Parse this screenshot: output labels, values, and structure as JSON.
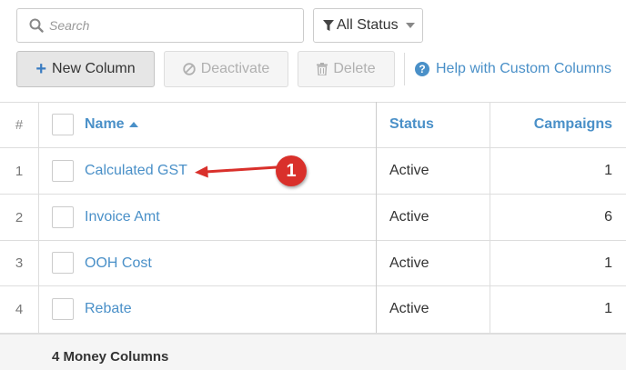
{
  "search": {
    "placeholder": "Search"
  },
  "status_filter": {
    "label": "All Status"
  },
  "toolbar": {
    "new_column_label": "New Column",
    "deactivate_label": "Deactivate",
    "delete_label": "Delete",
    "help_label": "Help with Custom Columns"
  },
  "table": {
    "headers": {
      "num": "#",
      "name": "Name",
      "status": "Status",
      "campaigns": "Campaigns"
    },
    "rows": [
      {
        "num": "1",
        "name": "Calculated GST",
        "status": "Active",
        "campaigns": "1"
      },
      {
        "num": "2",
        "name": "Invoice Amt",
        "status": "Active",
        "campaigns": "6"
      },
      {
        "num": "3",
        "name": "OOH Cost",
        "status": "Active",
        "campaigns": "1"
      },
      {
        "num": "4",
        "name": "Rebate",
        "status": "Active",
        "campaigns": "1"
      }
    ]
  },
  "footer": {
    "summary": "4 Money Columns"
  },
  "annotation": {
    "number": "1"
  },
  "colors": {
    "link": "#4a90c8",
    "annotation": "#d9302b"
  }
}
